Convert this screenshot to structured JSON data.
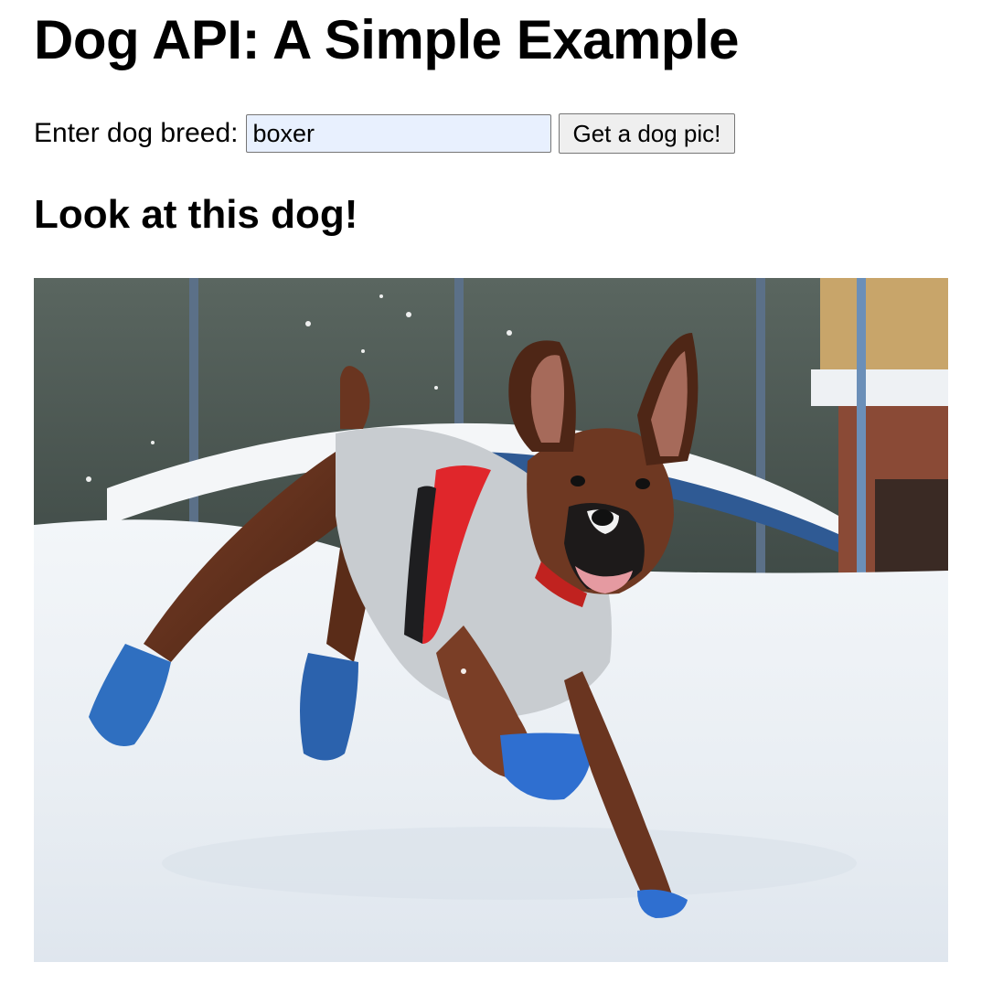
{
  "page": {
    "title": "Dog API: A Simple Example"
  },
  "form": {
    "label": "Enter dog breed:",
    "breed_input_value": "boxer",
    "submit_label": "Get a dog pic!"
  },
  "result": {
    "heading": "Look at this dog!",
    "image_alt": "boxer"
  },
  "colors": {
    "input_autofill_bg": "#e8f0fe",
    "button_bg": "#efefef",
    "text": "#000000"
  }
}
